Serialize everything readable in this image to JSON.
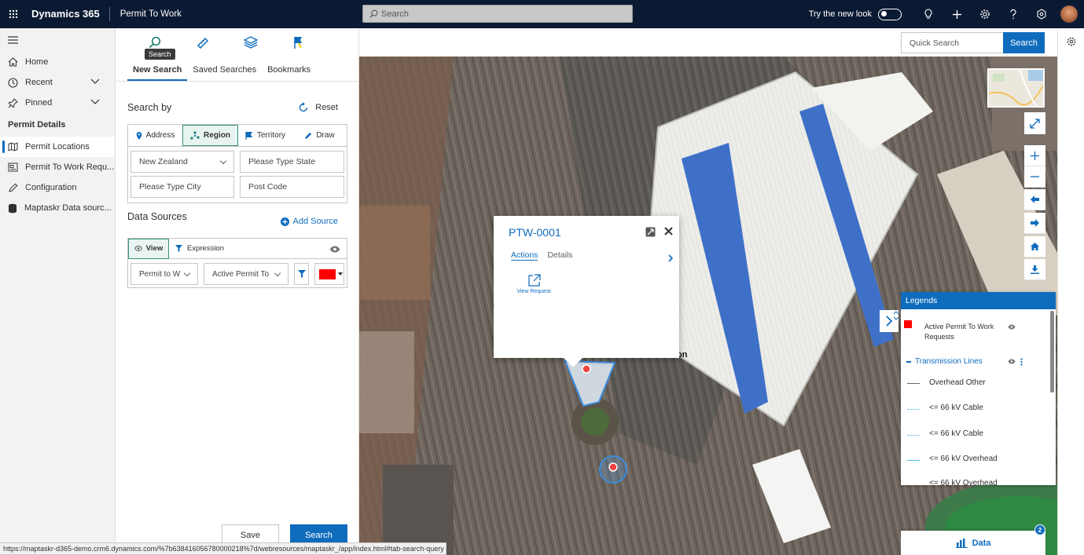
{
  "topbar": {
    "brand": "Dynamics 365",
    "app_name": "Permit To Work",
    "search_placeholder": "Search",
    "try_new_look": "Try the new look"
  },
  "nav": {
    "home": "Home",
    "recent": "Recent",
    "pinned": "Pinned",
    "section": "Permit Details",
    "items": [
      "Permit Locations",
      "Permit To Work Requ...",
      "Configuration",
      "Maptaskr Data sourc..."
    ]
  },
  "panel": {
    "tooltip": "Search",
    "subtabs": [
      "New Search",
      "Saved Searches",
      "Bookmarks"
    ],
    "search_by": "Search by",
    "reset": "Reset",
    "search_modes": [
      "Address",
      "Region",
      "Territory",
      "Draw"
    ],
    "selected_mode": "Region",
    "country": "New Zealand",
    "state_placeholder": "Please Type State",
    "city_placeholder": "Please Type City",
    "postcode_placeholder": "Post Code",
    "data_sources": "Data Sources",
    "add_source": "Add Source",
    "view_label": "View",
    "expression_label": "Expression",
    "entity_select": "Permit to W",
    "view_select": "Active Permit To",
    "layer_color": "#ff0000",
    "save": "Save",
    "search": "Search"
  },
  "map_toolbar": {
    "quick_search_placeholder": "Quick Search",
    "search_button": "Search"
  },
  "popup": {
    "title": "PTW-0001",
    "tabs": [
      "Actions",
      "Details"
    ],
    "view_request": "View Request"
  },
  "map_labels": {
    "partial_label": "on"
  },
  "legend": {
    "title": "Legends",
    "layer1": "Active Permit To Work Requests",
    "layer1_color": "#ff0000",
    "group": "Transmission Lines",
    "entries": [
      "Overhead Other",
      "<= 66 kV Cable",
      "<= 66 kV Cable",
      "<= 66 kV Overhead",
      "<= 66 kV Overhead"
    ]
  },
  "databar": {
    "label": "Data",
    "badge": "2"
  },
  "status_url": "https://maptaskr-d365-demo.crm6.dynamics.com/%7b638416056780000218%7d/webresources/maptaskr_/app/index.html#tab-search-query",
  "accent": "#0f6cbd"
}
